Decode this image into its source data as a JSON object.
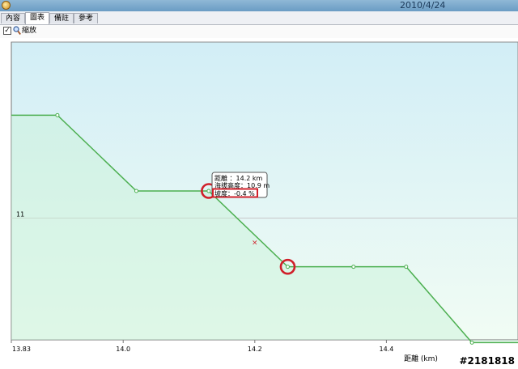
{
  "window": {
    "date": "2010/4/24"
  },
  "tabs": [
    {
      "label": "內容",
      "active": false
    },
    {
      "label": "圖表",
      "active": true
    },
    {
      "label": "備註",
      "active": false
    },
    {
      "label": "參考",
      "active": false
    }
  ],
  "toolbar": {
    "zoom_checked": true,
    "zoom_label": "縮放"
  },
  "tooltip": {
    "distance": "距離 ：14.2 km",
    "altitude": "海拔高度：10.9 m",
    "slope": "坡度：-0.4 %"
  },
  "watermark": "#2181818",
  "colors": {
    "line": "#4caf50",
    "highlight": "#d0202a",
    "plot_top": "#d2eef6",
    "plot_bottom": "#f1fcf4"
  },
  "chart_data": {
    "type": "area",
    "xlabel": "距離 (km)",
    "ylabel": "",
    "x_ticks": [
      13.83,
      14.0,
      14.2,
      14.4
    ],
    "x_tick_labels": [
      "13.83",
      "14.0",
      "14.2",
      "14.4"
    ],
    "y_ticks": [
      11
    ],
    "y_tick_labels": [
      "11"
    ],
    "xlim": [
      13.83,
      14.6
    ],
    "ylim": [
      10.55,
      11.65
    ],
    "grid": true,
    "series": [
      {
        "x": [
          13.83,
          13.9,
          14.02,
          14.13,
          14.25,
          14.35,
          14.43,
          14.53,
          14.6
        ],
        "y": [
          11.38,
          11.38,
          11.1,
          11.1,
          10.82,
          10.82,
          10.82,
          10.54,
          10.54
        ]
      }
    ],
    "hover_marker": {
      "x": 14.2,
      "y": 10.91
    },
    "highlighted_points": [
      {
        "x": 14.13,
        "y": 11.1
      },
      {
        "x": 14.25,
        "y": 10.82
      }
    ]
  }
}
